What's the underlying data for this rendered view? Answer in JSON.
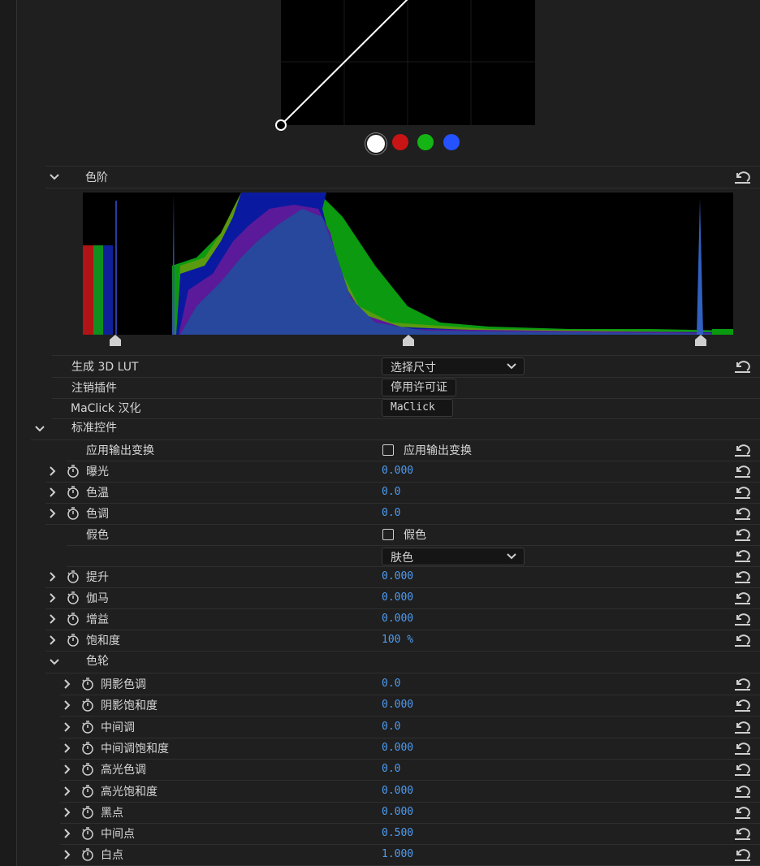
{
  "levels_section": {
    "title": "色阶"
  },
  "curve_channels": [
    "white",
    "red",
    "green",
    "blue"
  ],
  "colors": {
    "value_blue": "#4f9bf0",
    "channel_white": "#ffffff",
    "channel_red": "#c81414",
    "channel_green": "#13b413",
    "channel_blue": "#2452ff"
  },
  "lut_row": {
    "label": "生成 3D LUT",
    "dropdown": "选择尺寸"
  },
  "license_row": {
    "label": "注销插件",
    "button": "停用许可证"
  },
  "maclick_row": {
    "label": "MaClick 汉化",
    "button": "MaClick"
  },
  "standard_controls": {
    "title": "标准控件"
  },
  "output_transform": {
    "label": "应用输出变换",
    "checkbox_label": "应用输出变换"
  },
  "params": [
    {
      "label": "曝光",
      "value": "0.000"
    },
    {
      "label": "色温",
      "value": "0.0"
    },
    {
      "label": "色调",
      "value": "0.0"
    }
  ],
  "false_color": {
    "label": "假色",
    "checkbox_label": "假色",
    "dropdown": "肤色"
  },
  "params2": [
    {
      "label": "提升",
      "value": "0.000"
    },
    {
      "label": "伽马",
      "value": "0.000"
    },
    {
      "label": "增益",
      "value": "0.000"
    },
    {
      "label": "饱和度",
      "value": "100 %"
    }
  ],
  "color_wheels": {
    "title": "色轮"
  },
  "wheel_params": [
    {
      "label": "阴影色调",
      "value": "0.0"
    },
    {
      "label": "阴影饱和度",
      "value": "0.000"
    },
    {
      "label": "中间调",
      "value": "0.0"
    },
    {
      "label": "中间调饱和度",
      "value": "0.000"
    },
    {
      "label": "高光色调",
      "value": "0.0"
    },
    {
      "label": "高光饱和度",
      "value": "0.000"
    },
    {
      "label": "黑点",
      "value": "0.000"
    },
    {
      "label": "中间点",
      "value": "0.500"
    },
    {
      "label": "白点",
      "value": "1.000"
    }
  ]
}
